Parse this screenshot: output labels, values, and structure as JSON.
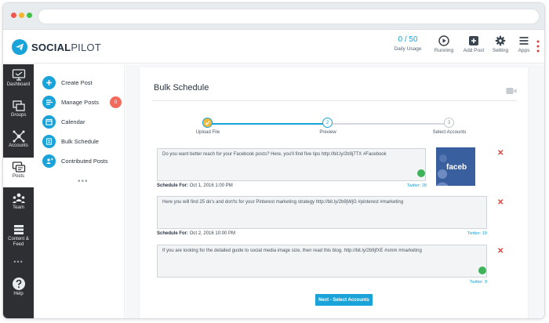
{
  "brand": {
    "name_a": "SOCIAL",
    "name_b": "PILOT",
    "accent": "#1aa3d9"
  },
  "topbar": {
    "usage_value": "0 / 50",
    "usage_label": "Daily Usage",
    "running_label": "Running",
    "add_post_label": "Add Post",
    "setting_label": "Setting",
    "apps_label": "Apps"
  },
  "leftnav": [
    {
      "label": "Dashboard",
      "icon": "dashboard-icon"
    },
    {
      "label": "Groups",
      "icon": "groups-icon"
    },
    {
      "label": "Accounts",
      "icon": "accounts-icon"
    },
    {
      "label": "Posts",
      "icon": "posts-icon",
      "active": true
    },
    {
      "label": "Team",
      "icon": "team-icon"
    },
    {
      "label": "Content & Feed",
      "icon": "content-feed-icon"
    },
    {
      "label": "Help",
      "icon": "help-icon"
    }
  ],
  "subnav": {
    "create_post": "Create Post",
    "manage_posts": "Manage Posts",
    "manage_posts_badge": "0",
    "calendar": "Calendar",
    "bulk_schedule": "Bulk Schedule",
    "contributed_posts": "Contributed Posts"
  },
  "page": {
    "title": "Bulk Schedule"
  },
  "steps": [
    {
      "label": "Upload File",
      "number": "",
      "state": "done"
    },
    {
      "label": "Preview",
      "number": "2",
      "state": "current"
    },
    {
      "label": "Select Accounts",
      "number": "3",
      "state": "pending"
    }
  ],
  "posts": [
    {
      "text": "Do you want better reach for your Facebook posts? Here, you'll find five tips http://bit.ly/2b9j7TX #Facebook",
      "schedule_label": "Schedule For:",
      "schedule_value": "Oct 1, 2016 1:00 PM",
      "counter": "Twitter: 28",
      "thumbnail_text": "faceb"
    },
    {
      "text": "Here you will find 25 do's and don'ts for your Pinterest marketing strategy http://bit.ly/2b9jWjG #pinterest #marketing",
      "schedule_label": "Schedule For:",
      "schedule_value": "Oct 2, 2016 10:00 PM",
      "counter": "Twitter: 19"
    },
    {
      "text": "If you are looking for the detailed guide to social media image size, then read this blog. http://bit.ly/2b9jfXE #smm #marketing",
      "counter": "Twitter: 9"
    }
  ],
  "next_button": "Next - Select Accounts"
}
